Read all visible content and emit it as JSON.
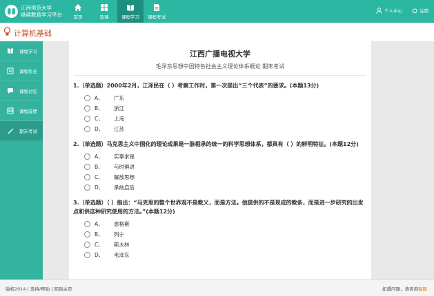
{
  "app": {
    "logo_line1": "江西师范大学",
    "logo_line2": "继续教育学习平台",
    "accent": "#2bb7a2"
  },
  "nav": [
    {
      "label": "首页",
      "icon": "home-icon"
    },
    {
      "label": "选课",
      "icon": "grid-icon"
    },
    {
      "label": "课程学习",
      "icon": "book-icon"
    },
    {
      "label": "课程考试",
      "icon": "document-icon"
    }
  ],
  "user": {
    "center_label": "个人中心",
    "logout_label": "注销"
  },
  "course": {
    "title": "计算机基础"
  },
  "sidebar": [
    {
      "label": "课程学习",
      "icon": "book-icon"
    },
    {
      "label": "课程作业",
      "icon": "list-icon"
    },
    {
      "label": "课程讨论",
      "icon": "chat-icon"
    },
    {
      "label": "课程成绩",
      "icon": "table-icon"
    },
    {
      "label": "期末考试",
      "icon": "pen-icon"
    }
  ],
  "exam": {
    "school": "江西广播电视大学",
    "subtitle": "毛泽东思想中国特色社会主义理论体系概论 期末考试",
    "questions": [
      {
        "text": "1.（单选题）2000年2月，江泽民在（ ）考察工作时，第一次提出“三个代表”的要求。(本题13分)",
        "options": [
          {
            "letter": "A、",
            "text": "广东"
          },
          {
            "letter": "B、",
            "text": "浙江"
          },
          {
            "letter": "C、",
            "text": "上海"
          },
          {
            "letter": "D、",
            "text": "江苏"
          }
        ]
      },
      {
        "text": "2.（单选题）马克思主义中国化的理论成果是一脉相承的统一的科学思想体系，都具有（ ）的鲜明特征。(本题12分)",
        "options": [
          {
            "letter": "A、",
            "text": "实事求是"
          },
          {
            "letter": "B、",
            "text": "与时俱进"
          },
          {
            "letter": "C、",
            "text": "解放思想"
          },
          {
            "letter": "D、",
            "text": "承前启后"
          }
        ]
      },
      {
        "text": "3.（单选题）（ ）指出：“马克思的整个世界观不是教义，而是方法。他提供的不是现成的教条，而是进一步研究的出发点和供这种研究使用的方法。”(本题12分)",
        "options": [
          {
            "letter": "A、",
            "text": "恩格斯"
          },
          {
            "letter": "B、",
            "text": "列宁"
          },
          {
            "letter": "C、",
            "text": "斯大林"
          },
          {
            "letter": "D、",
            "text": "毛泽东"
          }
        ]
      }
    ]
  },
  "footer": {
    "left": "版权2014 | 支持/帮助 | 回到主页",
    "right_prefix": "如遇问题，请咨询",
    "right_link": "客服"
  }
}
